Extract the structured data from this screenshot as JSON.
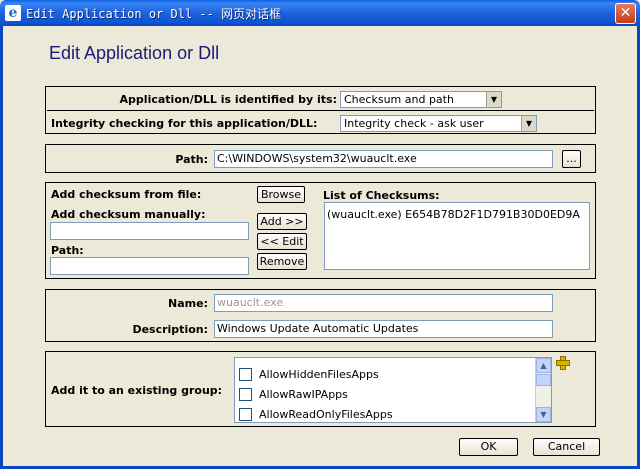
{
  "window": {
    "title": "Edit Application or Dll -- 网页对话框",
    "close_glyph": "✕",
    "app_icon_glyph": "e"
  },
  "heading": "Edit Application or Dll",
  "identification": {
    "identified_label": "Application/DLL is identified by its:",
    "identified_value": "Checksum and path",
    "integrity_label": "Integrity checking for this application/DLL:",
    "integrity_value": "Integrity check - ask user"
  },
  "path_section": {
    "label": "Path:",
    "value": "C:\\WINDOWS\\system32\\wuauclt.exe",
    "browse_button": "..."
  },
  "checksums": {
    "from_file_label": "Add checksum from file:",
    "browse_button": "Browse",
    "manual_label": "Add checksum manually:",
    "manual_value": "",
    "path_label": "Path:",
    "path_value": "",
    "add_button": "Add >>",
    "edit_button": "<< Edit",
    "remove_button": "Remove",
    "list_label": "List of Checksums:",
    "list_items": [
      "(wuauclt.exe) E654B78D2F1D791B30D0ED9A"
    ]
  },
  "details": {
    "name_label": "Name:",
    "name_value": "wuauclt.exe",
    "description_label": "Description:",
    "description_value": "Windows Update Automatic Updates"
  },
  "groups": {
    "label": "Add it to an existing group:",
    "items": [
      {
        "label": "AllowHiddenFilesApps",
        "checked": false
      },
      {
        "label": "AllowRawIPApps",
        "checked": false
      },
      {
        "label": "AllowReadOnlyFilesApps",
        "checked": false
      }
    ]
  },
  "footer": {
    "ok_button": "OK",
    "cancel_button": "Cancel"
  }
}
